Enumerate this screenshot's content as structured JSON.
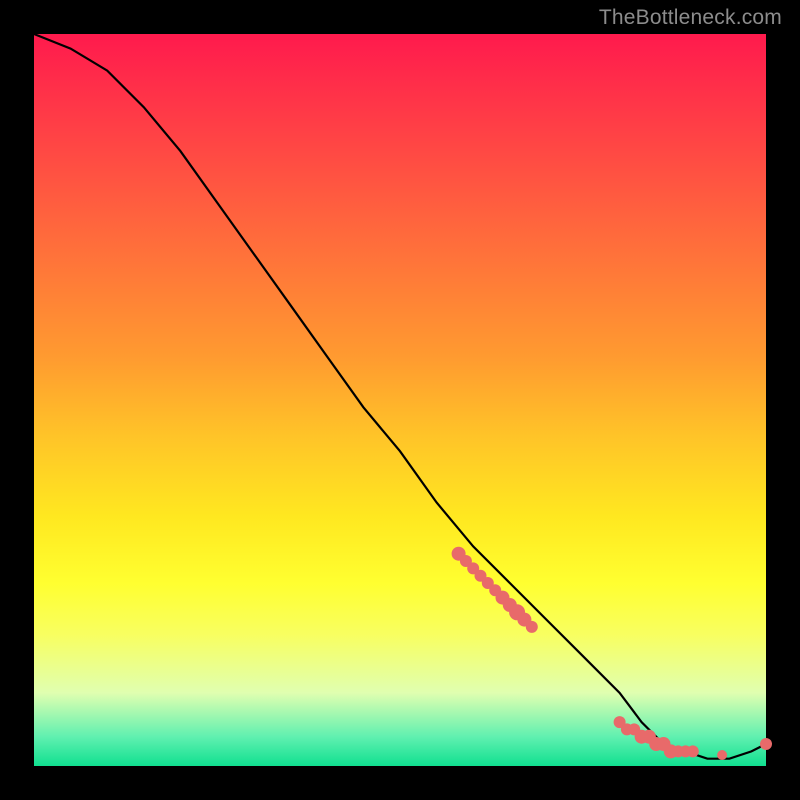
{
  "watermark": "TheBottleneck.com",
  "chart_data": {
    "type": "line",
    "title": "",
    "xlabel": "",
    "ylabel": "",
    "xlim": [
      0,
      100
    ],
    "ylim": [
      0,
      100
    ],
    "series": [
      {
        "name": "bottleneck-curve",
        "x": [
          0,
          5,
          10,
          15,
          20,
          25,
          30,
          35,
          40,
          45,
          50,
          55,
          60,
          65,
          70,
          75,
          80,
          83,
          86,
          89,
          92,
          95,
          98,
          100
        ],
        "y": [
          100,
          98,
          95,
          90,
          84,
          77,
          70,
          63,
          56,
          49,
          43,
          36,
          30,
          25,
          20,
          15,
          10,
          6,
          3,
          2,
          1,
          1,
          2,
          3
        ],
        "color": "#000000",
        "marker_color": "#e86a6a"
      }
    ],
    "markers": {
      "name": "highlight-dots",
      "x": [
        58,
        59,
        60,
        61,
        62,
        63,
        64,
        65,
        66,
        67,
        68,
        80,
        81,
        82,
        83,
        84,
        85,
        86,
        87,
        88,
        89,
        90,
        94,
        100
      ],
      "y": [
        29,
        28,
        27,
        26,
        25,
        24,
        23,
        22,
        21,
        20,
        19,
        6,
        5,
        5,
        4,
        4,
        3,
        3,
        2,
        2,
        2,
        2,
        1.5,
        3
      ],
      "r": [
        7,
        6,
        6,
        6,
        6,
        6,
        7,
        7,
        8,
        7,
        6,
        6,
        6,
        6,
        7,
        7,
        7,
        7,
        7,
        6,
        6,
        6,
        5,
        6
      ]
    }
  }
}
